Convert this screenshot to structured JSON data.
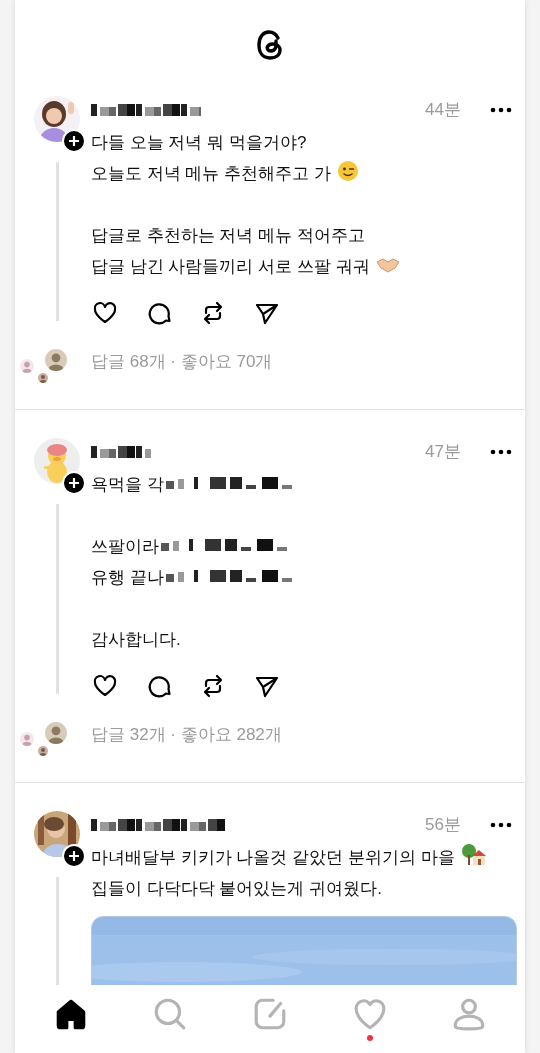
{
  "posts": [
    {
      "time": "44분",
      "paragraphs": [
        [
          {
            "text": "다들 오늘 저녁 뭐 먹을거야?",
            "kind": "plain"
          },
          {
            "text": "오늘도 저녁 메뉴 추천해주고 가",
            "kind": "wink"
          }
        ],
        [
          {
            "text": "답글로 추천하는 저녁 메뉴 적어주고",
            "kind": "plain"
          },
          {
            "text": "답글 남긴 사람들끼리 서로 쓰팔 궈궈",
            "kind": "handshake"
          }
        ]
      ],
      "stats": "답글 68개 · 좋아요 70개"
    },
    {
      "time": "47분",
      "paragraphs": [
        [
          {
            "text": "욕먹을 각",
            "kind": "blurred"
          }
        ],
        [
          {
            "text": "쓰팔이라",
            "kind": "blurred"
          },
          {
            "text": "유행 끝나",
            "kind": "blurred"
          }
        ],
        [
          {
            "text": "감사합니다.",
            "kind": "plain"
          }
        ]
      ],
      "stats": "답글 32개 · 좋아요 282개"
    },
    {
      "time": "56분",
      "paragraphs": [
        [
          {
            "text": "마녀배달부 키키가 나올것 같았던 분위기의 마을",
            "kind": "house"
          },
          {
            "text": "집들이 다닥다닥 붙어있는게 귀여웠다.",
            "kind": "plain"
          }
        ]
      ],
      "media": {
        "kind": "picture"
      }
    }
  ],
  "nav": [
    {
      "kind": "home",
      "selected": true
    },
    {
      "kind": "search",
      "selected": false
    },
    {
      "kind": "compose",
      "selected": false
    },
    {
      "kind": "activity",
      "selected": false,
      "unread": true
    },
    {
      "kind": "profile",
      "selected": false
    }
  ]
}
